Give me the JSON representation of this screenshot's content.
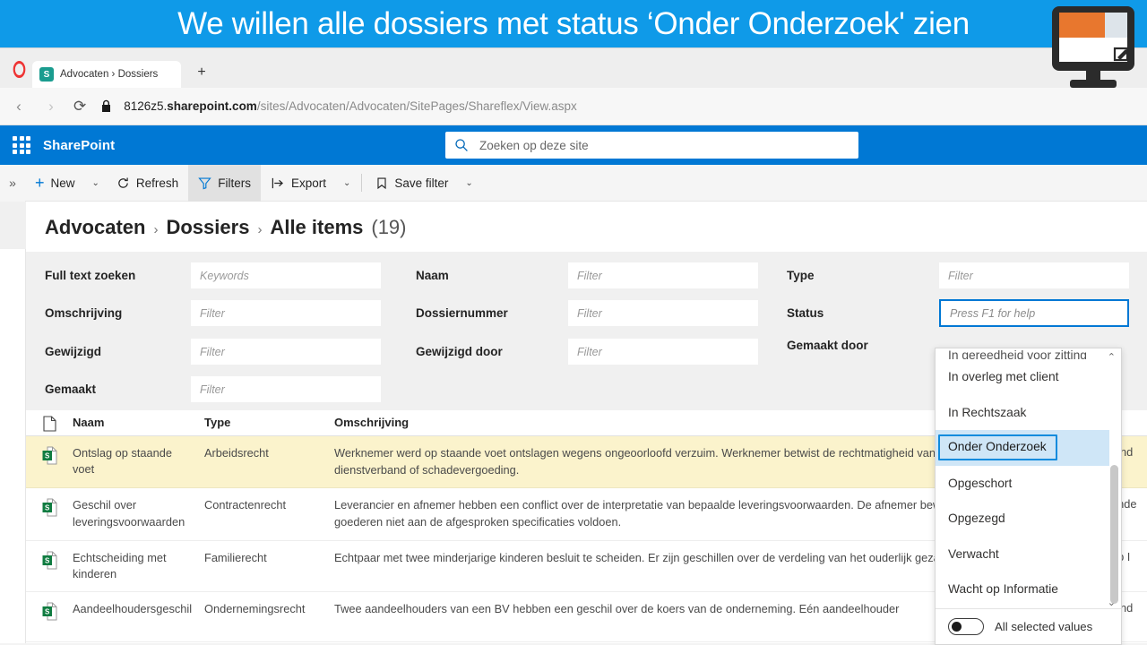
{
  "banner": {
    "text": "We willen alle dossiers met status ‘Onder Onderzoek' zien"
  },
  "browser": {
    "tab": {
      "title": "Advocaten › Dossiers",
      "favicon": "sharepoint-favicon",
      "letter": "S"
    },
    "new_tab_label": "+",
    "nav": {
      "back": "‹",
      "forward": "›",
      "reload": "⟳",
      "lock": "lock-icon"
    },
    "url": {
      "host_prefix": "8126z5.",
      "host_bold": "sharepoint.com",
      "path": "/sites/Advocaten/Advocaten/SitePages/Shareflex/View.aspx"
    }
  },
  "suitebar": {
    "waffle": "app-launcher-icon",
    "brand": "SharePoint",
    "search_placeholder": "Zoeken op deze site",
    "search_icon": "search-icon"
  },
  "commandbar": {
    "overflow": "»",
    "items": [
      {
        "label": "New",
        "icon": "plus-icon",
        "has_caret": true,
        "active": false
      },
      {
        "label": "Refresh",
        "icon": "refresh-icon",
        "has_caret": false,
        "active": false
      },
      {
        "label": "Filters",
        "icon": "funnel-icon",
        "has_caret": false,
        "active": true
      },
      {
        "label": "Export",
        "icon": "export-icon",
        "has_caret": true,
        "active": false
      },
      {
        "label": "Save filter",
        "icon": "bookmark-icon",
        "has_caret": true,
        "active": false
      }
    ]
  },
  "breadcrumb": {
    "site": "Advocaten",
    "list": "Dossiers",
    "view": "Alle items",
    "count": "(19)",
    "separator": "›"
  },
  "filters": [
    {
      "label": "Full text zoeken",
      "placeholder": "Keywords",
      "value": "",
      "focused": false,
      "name": "full-text-zoeken"
    },
    {
      "label": "Naam",
      "placeholder": "Filter",
      "value": "",
      "focused": false,
      "name": "naam"
    },
    {
      "label": "Type",
      "placeholder": "Filter",
      "value": "",
      "focused": false,
      "name": "type"
    },
    {
      "label": "Omschrijving",
      "placeholder": "Filter",
      "value": "",
      "focused": false,
      "name": "omschrijving"
    },
    {
      "label": "Dossiernummer",
      "placeholder": "Filter",
      "value": "",
      "focused": false,
      "name": "dossiernummer"
    },
    {
      "label": "Status",
      "placeholder": "Press F1 for help",
      "value": "",
      "focused": true,
      "name": "status"
    },
    {
      "label": "Gewijzigd",
      "placeholder": "Filter",
      "value": "",
      "focused": false,
      "name": "gewijzigd"
    },
    {
      "label": "Gewijzigd door",
      "placeholder": "Filter",
      "value": "",
      "focused": false,
      "name": "gewijzigd-door"
    },
    {
      "label": "Gemaakt door",
      "placeholder": "",
      "value": "",
      "focused": false,
      "name": "gemaakt-door"
    },
    {
      "label": "Gemaakt",
      "placeholder": "Filter",
      "value": "",
      "focused": false,
      "name": "gemaakt"
    }
  ],
  "table": {
    "headers": {
      "icon": "document-icon",
      "naam": "Naam",
      "type": "Type",
      "omschrijving": "Omschrijving"
    },
    "rows": [
      {
        "naam": "Ontslag op staande voet",
        "type": "Arbeidsrecht",
        "omschrijving": "Werknemer werd op staande voet ontslagen wegens ongeoorloofd verzuim. Werknemer betwist de rechtmatigheid van het ontslag en eist herstel van dienstverband of schadevergoeding.",
        "status_partial": "Ond",
        "highlighted": true
      },
      {
        "naam": "Geschil over leveringsvoorwaarden",
        "type": "Contractenrecht",
        "omschrijving": "Leverancier en afnemer hebben een conflict over de interpretatie van bepaalde leveringsvoorwaarden. De afnemer beweert dat de geleverde goederen niet aan de afgesproken specificaties voldoen.",
        "status_partial": "ande",
        "highlighted": false
      },
      {
        "naam": "Echtscheiding met kinderen",
        "type": "Familierecht",
        "omschrijving": "Echtpaar met twee minderjarige kinderen besluit te scheiden. Er zijn geschillen over de verdeling van het ouderlijk gezag en de zorgregeling.",
        "status_partial": "op I",
        "highlighted": false
      },
      {
        "naam": "Aandeelhoudersgeschil",
        "type": "Ondernemingsrecht",
        "omschrijving": "Twee aandeelhouders van een BV hebben een geschil over de koers van de onderneming. Eén aandeelhouder",
        "status_partial": "Ond",
        "highlighted": false
      }
    ]
  },
  "dropdown": {
    "cut_item": "In gereedheid voor zitting",
    "items": [
      {
        "label": "In overleg met client",
        "selected": false
      },
      {
        "label": "In Rechtszaak",
        "selected": false
      },
      {
        "label": "Onder Onderzoek",
        "selected": true
      },
      {
        "label": "Opgeschort",
        "selected": false
      },
      {
        "label": "Opgezegd",
        "selected": false
      },
      {
        "label": "Verwacht",
        "selected": false
      },
      {
        "label": "Wacht op Informatie",
        "selected": false
      }
    ],
    "scroll_up_icon": "chevron-up-icon",
    "scroll_down_icon": "chevron-down-icon",
    "footer": {
      "toggle_state": "off",
      "label": "All selected values"
    }
  },
  "overlay": {
    "monitor_icon": "screen-recording-icon"
  },
  "colors": {
    "banner_blue": "#0f9ae8",
    "sharepoint_blue": "#0078d4",
    "highlight_row": "#fbf3cc",
    "selected_item": "#cfe6f7",
    "focus_border": "#0078d4"
  }
}
